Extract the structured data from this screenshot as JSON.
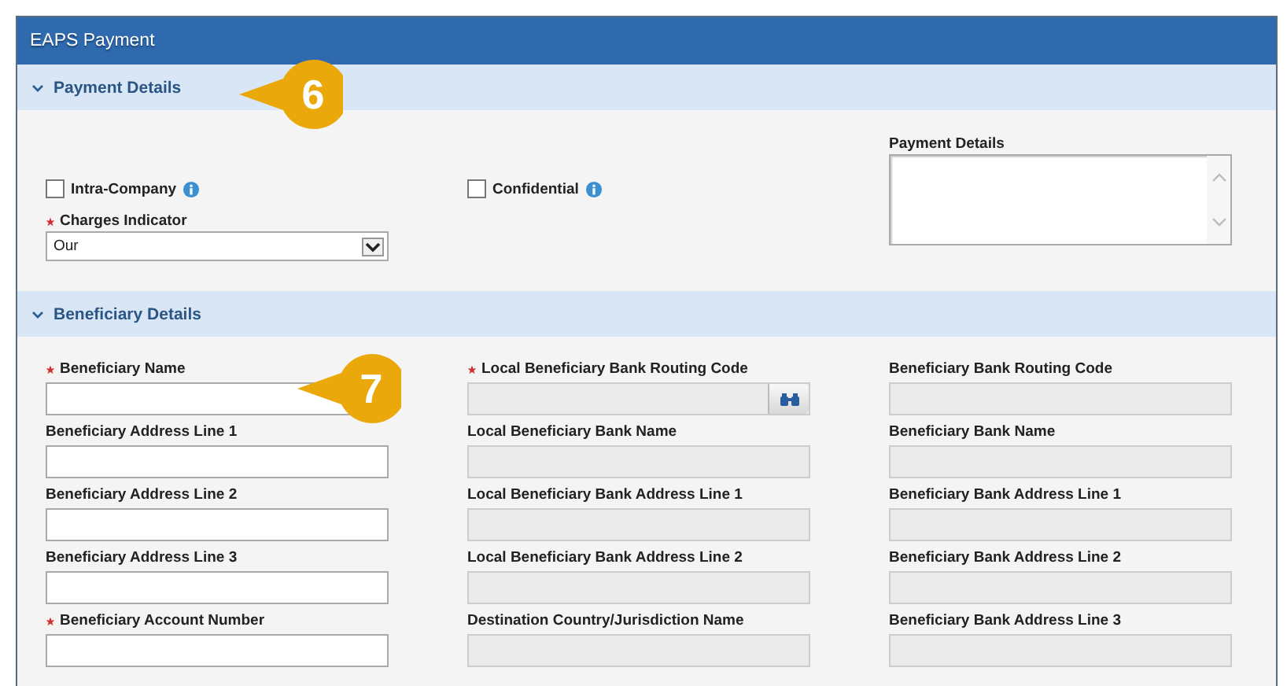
{
  "window": {
    "title": "EAPS Payment"
  },
  "payment_section": {
    "title": "Payment Details",
    "expanded": true,
    "checkboxes": [
      {
        "label": "Intra-Company",
        "checked": false
      },
      {
        "label": "Confidential",
        "checked": false
      }
    ],
    "charges": {
      "label": "Charges Indicator",
      "required": true,
      "value": "Our"
    },
    "details": {
      "label": "Payment Details"
    }
  },
  "beneficiary_section": {
    "title": "Beneficiary Details",
    "expanded": true,
    "fields": [
      {
        "label": "Beneficiary Name",
        "required": true,
        "disabled": false,
        "kind": "text"
      },
      {
        "label": "Local Beneficiary Bank Routing Code",
        "required": true,
        "disabled": true,
        "kind": "lookup"
      },
      {
        "label": "Beneficiary Bank Routing Code",
        "required": false,
        "disabled": true,
        "kind": "text"
      },
      {
        "label": "Beneficiary Address Line 1",
        "required": false,
        "disabled": false,
        "kind": "text"
      },
      {
        "label": "Local Beneficiary Bank Name",
        "required": false,
        "disabled": true,
        "kind": "text"
      },
      {
        "label": "Beneficiary Bank Name",
        "required": false,
        "disabled": true,
        "kind": "text"
      },
      {
        "label": "Beneficiary Address Line 2",
        "required": false,
        "disabled": false,
        "kind": "text"
      },
      {
        "label": "Local Beneficiary Bank Address Line 1",
        "required": false,
        "disabled": true,
        "kind": "text"
      },
      {
        "label": "Beneficiary Bank Address Line 1",
        "required": false,
        "disabled": true,
        "kind": "text"
      },
      {
        "label": "Beneficiary Address Line 3",
        "required": false,
        "disabled": false,
        "kind": "text"
      },
      {
        "label": "Local Beneficiary Bank Address Line 2",
        "required": false,
        "disabled": true,
        "kind": "text"
      },
      {
        "label": "Beneficiary Bank Address Line 2",
        "required": false,
        "disabled": true,
        "kind": "text"
      },
      {
        "label": "Beneficiary Account Number",
        "required": true,
        "disabled": false,
        "kind": "text"
      },
      {
        "label": "Destination Country/Jurisdiction Name",
        "required": false,
        "disabled": true,
        "kind": "text"
      },
      {
        "label": "Beneficiary Bank Address Line 3",
        "required": false,
        "disabled": true,
        "kind": "text"
      }
    ]
  },
  "callouts": [
    {
      "number": "6"
    },
    {
      "number": "7"
    }
  ]
}
